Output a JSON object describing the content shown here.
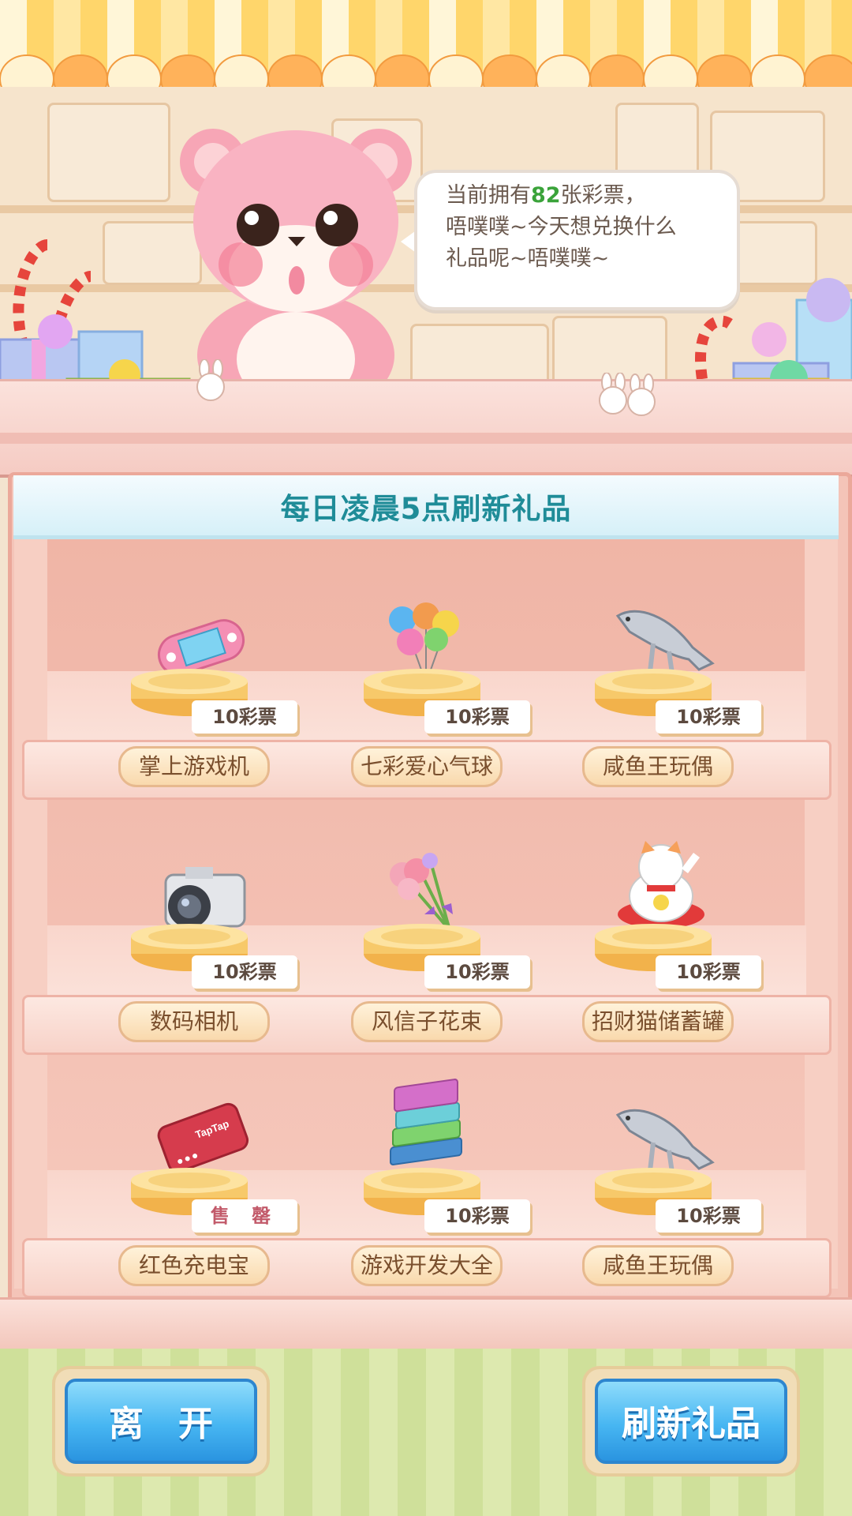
{
  "npc": {
    "speech_prefix": "当前拥有",
    "ticket_count": "82",
    "speech_suffix": "张彩票，",
    "speech_line2": "唔噗噗~今天想兑换什么",
    "speech_line3": "礼品呢~唔噗噗~"
  },
  "shop": {
    "banner": "每日凌晨5点刷新礼品",
    "shelves": [
      [
        {
          "name": "掌上游戏机",
          "price": "10彩票",
          "icon": "handheld-console-icon"
        },
        {
          "name": "七彩爱心气球",
          "price": "10彩票",
          "icon": "heart-balloons-icon"
        },
        {
          "name": "咸鱼王玩偶",
          "price": "10彩票",
          "icon": "salted-fish-doll-icon"
        }
      ],
      [
        {
          "name": "数码相机",
          "price": "10彩票",
          "icon": "digital-camera-icon"
        },
        {
          "name": "风信子花束",
          "price": "10彩票",
          "icon": "hyacinth-bouquet-icon"
        },
        {
          "name": "招财猫储蓄罐",
          "price": "10彩票",
          "icon": "lucky-cat-piggybank-icon"
        }
      ],
      [
        {
          "name": "红色充电宝",
          "price": "售 罄",
          "icon": "red-power-bank-icon",
          "sold_out": true
        },
        {
          "name": "游戏开发大全",
          "price": "10彩票",
          "icon": "game-dev-books-icon"
        },
        {
          "name": "咸鱼王玩偶",
          "price": "10彩票",
          "icon": "salted-fish-doll-icon"
        }
      ]
    ],
    "power_bank_brand": "TapTap"
  },
  "buttons": {
    "leave": "离　开",
    "refresh": "刷新礼品"
  },
  "colors": {
    "ticket_count": "#3aa33a",
    "banner_text": "#1f8c98",
    "button_blue": "#47b6f2",
    "sold_out": "#c25a6a"
  }
}
